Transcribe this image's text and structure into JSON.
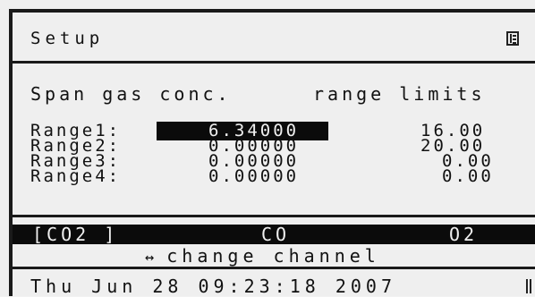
{
  "header": {
    "title": "Setup",
    "menu_icon": "menu-icon"
  },
  "table": {
    "heading_label": "Span gas conc.",
    "heading_limits": "range limits",
    "rows": [
      {
        "label": "Range1:",
        "value": "6.34000",
        "limit": "16.00",
        "selected": true
      },
      {
        "label": "Range2:",
        "value": "0.00000",
        "limit": "20.00",
        "selected": false
      },
      {
        "label": "Range3:",
        "value": "0.00000",
        "limit": "0.00",
        "selected": false
      },
      {
        "label": "Range4:",
        "value": "0.00000",
        "limit": "0.00",
        "selected": false
      }
    ]
  },
  "channels": {
    "items": [
      "[CO2 ]",
      "CO",
      "O2"
    ],
    "hint": "change channel",
    "hint_icon": "left-right-arrow-icon"
  },
  "footer": {
    "datetime": "Thu Jun 28 09:23:18 2007"
  },
  "colors": {
    "background": "#efefef",
    "foreground": "#111111",
    "highlight": "#0b0b0b"
  }
}
